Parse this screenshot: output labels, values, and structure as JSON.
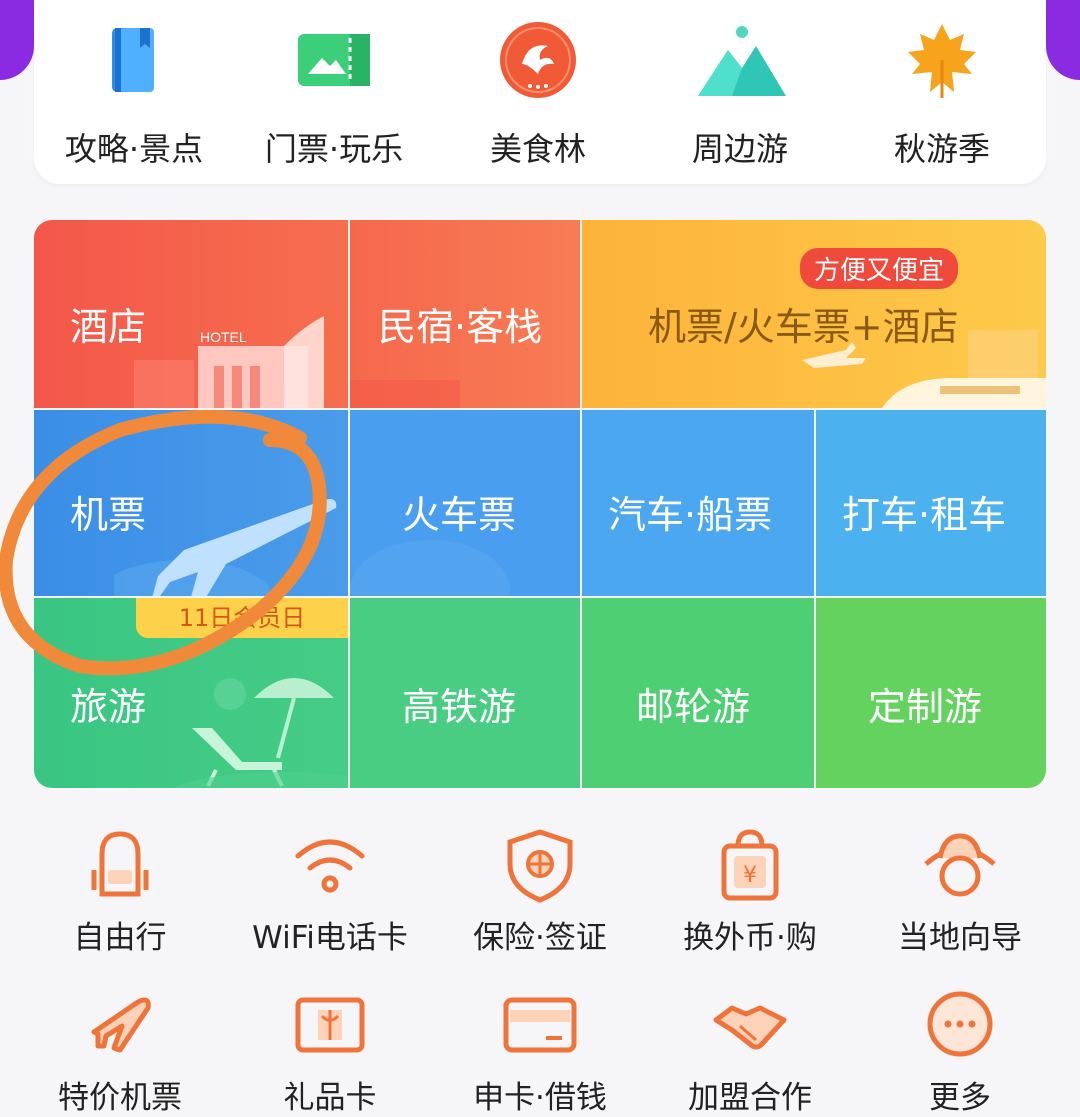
{
  "top_shortcuts": [
    {
      "label": "攻略·景点",
      "icon": "guidebook-icon"
    },
    {
      "label": "门票·玩乐",
      "icon": "ticket-icon"
    },
    {
      "label": "美食林",
      "icon": "food-dolphin-badge-icon"
    },
    {
      "label": "周边游",
      "icon": "mountain-icon"
    },
    {
      "label": "秋游季",
      "icon": "maple-leaf-icon"
    }
  ],
  "grid": {
    "hotel": "酒店",
    "hotel_sign": "HOTEL",
    "homestay": "民宿·客栈",
    "package": "机票/火车票+酒店",
    "package_badge": "方便又便宜",
    "flight": "机票",
    "train": "火车票",
    "bus_ship": "汽车·船票",
    "taxi_rental": "打车·租车",
    "tour": "旅游",
    "tour_badge": "11日会员日",
    "hsr_tour": "高铁游",
    "cruise": "邮轮游",
    "custom_tour": "定制游"
  },
  "services_row1": [
    {
      "label": "自由行",
      "icon": "backpack-icon"
    },
    {
      "label": "WiFi电话卡",
      "icon": "wifi-icon"
    },
    {
      "label": "保险·签证",
      "icon": "shield-globe-icon"
    },
    {
      "label": "换外币·购",
      "icon": "yen-bag-icon"
    },
    {
      "label": "当地向导",
      "icon": "guide-hat-icon"
    }
  ],
  "services_row2": [
    {
      "label": "特价机票",
      "icon": "plane-icon"
    },
    {
      "label": "礼品卡",
      "icon": "gift-card-icon"
    },
    {
      "label": "申卡·借钱",
      "icon": "credit-card-icon"
    },
    {
      "label": "加盟合作",
      "icon": "handshake-icon"
    },
    {
      "label": "更多",
      "icon": "more-icon"
    }
  ],
  "colors": {
    "accent_orange": "#f0743a",
    "hotel_red": "#f4574a",
    "package_yellow": "#fdbe3f",
    "transport_blue": "#3f9ae6",
    "tour_green": "#3ec97a",
    "purple": "#8a2be2",
    "annotation": "#f08a3a"
  }
}
